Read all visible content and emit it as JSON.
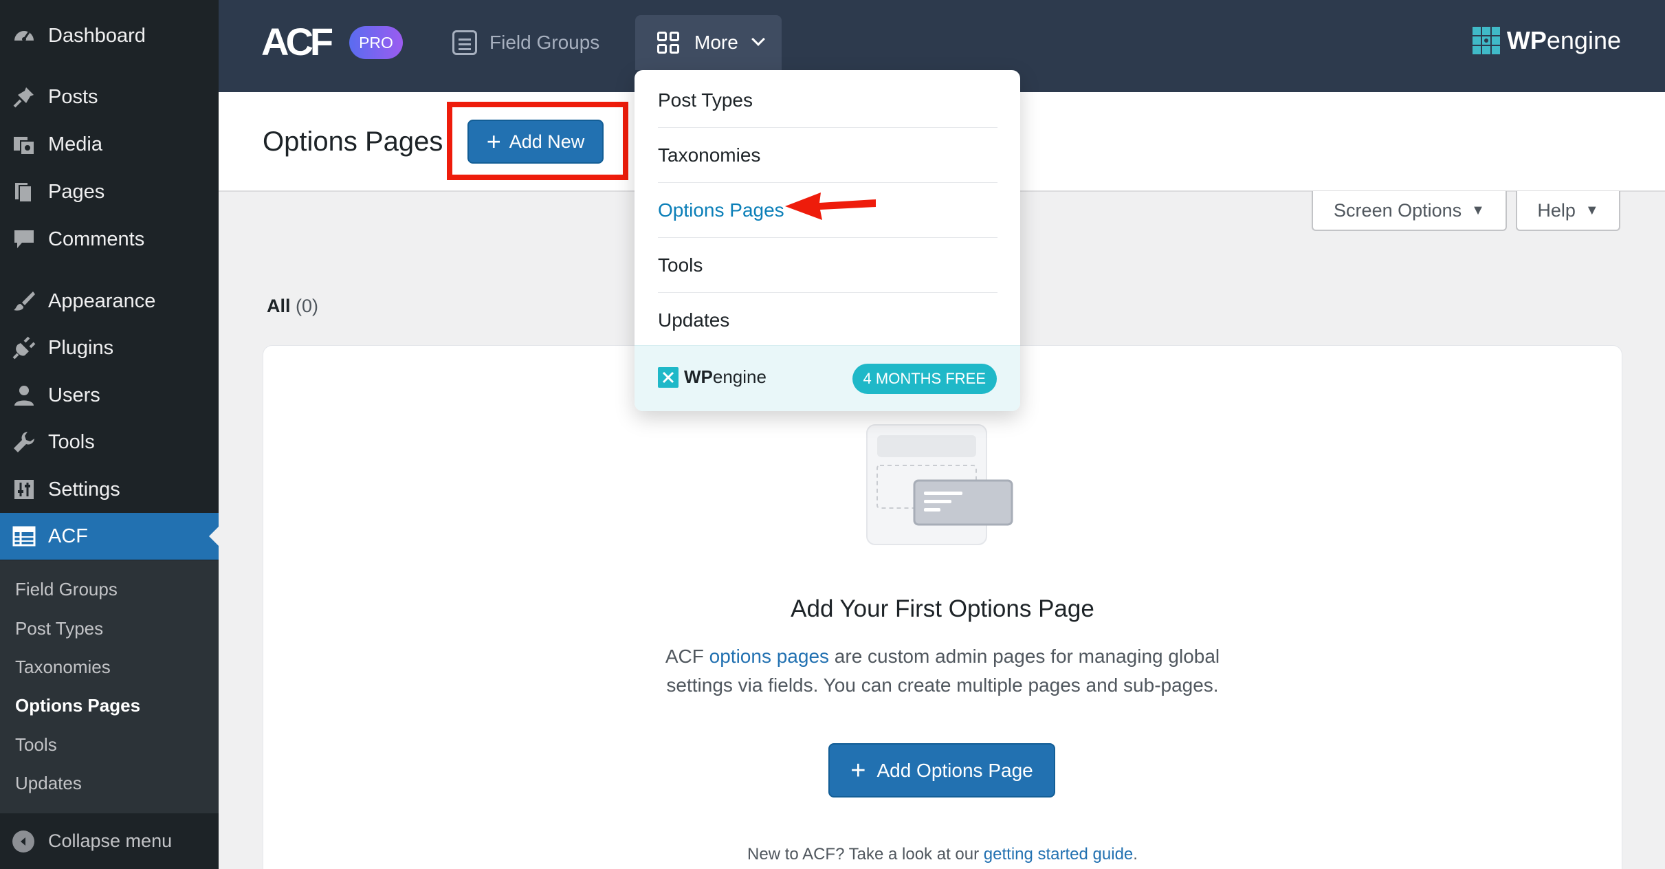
{
  "sidebar": {
    "items": [
      {
        "label": "Dashboard",
        "icon": "dashboard-icon"
      },
      {
        "label": "Posts",
        "icon": "pin-icon"
      },
      {
        "label": "Media",
        "icon": "media-icon"
      },
      {
        "label": "Pages",
        "icon": "pages-icon"
      },
      {
        "label": "Comments",
        "icon": "comment-icon"
      },
      {
        "label": "Appearance",
        "icon": "brush-icon"
      },
      {
        "label": "Plugins",
        "icon": "plug-icon"
      },
      {
        "label": "Users",
        "icon": "user-icon"
      },
      {
        "label": "Tools",
        "icon": "wrench-icon"
      },
      {
        "label": "Settings",
        "icon": "sliders-icon"
      },
      {
        "label": "ACF",
        "icon": "table-icon"
      }
    ],
    "submenu": [
      "Field Groups",
      "Post Types",
      "Taxonomies",
      "Options Pages",
      "Tools",
      "Updates"
    ],
    "current_submenu": "Options Pages",
    "collapse_label": "Collapse menu"
  },
  "header": {
    "logo": "ACF",
    "badge": "PRO",
    "nav_field_groups": "Field Groups",
    "nav_more": "More",
    "partner_logo_bold": "WP",
    "partner_logo_light": "engine"
  },
  "more_menu": {
    "items": [
      "Post Types",
      "Taxonomies",
      "Options Pages",
      "Tools",
      "Updates"
    ],
    "selected": "Options Pages",
    "footer_logo_bold": "WP",
    "footer_logo_light": "engine",
    "promo": "4 MONTHS FREE"
  },
  "page": {
    "title": "Options Pages",
    "add_new": "Add New",
    "screen_options": "Screen Options",
    "help": "Help",
    "filter_label": "All",
    "filter_count": "(0)"
  },
  "empty_state": {
    "title": "Add Your First Options Page",
    "desc_prefix": "ACF",
    "desc_link": "options pages",
    "desc_line1_suffix": "are custom admin pages for managing global",
    "desc_line2": "settings via fields. You can create multiple pages and sub-pages.",
    "button": "Add Options Page",
    "guide_prefix": "New to ACF? Take a look at our",
    "guide_link": "getting started guide",
    "guide_suffix": "."
  },
  "colors": {
    "sidebar_bg": "#1d2327",
    "accent": "#2271b1",
    "topbar_bg": "#2d3a4d",
    "annotation_red": "#ee1c0b",
    "promo_teal": "#1fb8c8"
  }
}
